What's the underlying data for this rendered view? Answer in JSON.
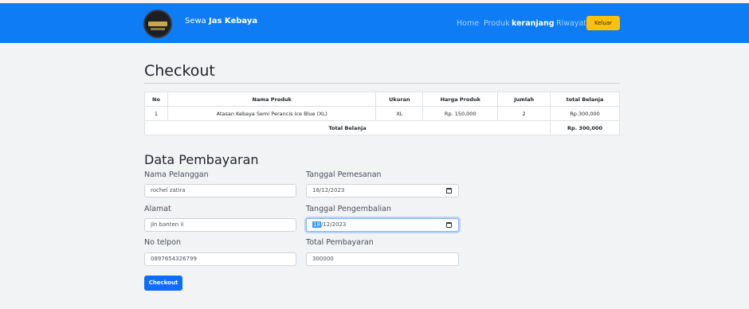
{
  "nav": {
    "brand_prefix": "Sewa",
    "brand_name": "Jas Kebaya",
    "links": [
      "Home",
      "Produk",
      "keranjang",
      "Riwayat"
    ],
    "logout_label": "Keluar",
    "bg_color": "#0d7cf5"
  },
  "page": {
    "title": "Checkout"
  },
  "table": {
    "columns": [
      "No",
      "Nama Produk",
      "Ukuran",
      "Harga Produk",
      "Jumlah",
      "total Belanja"
    ],
    "rows": [
      [
        "1",
        "Atasan Kebaya Semi Perancis Ice Blue (XL)",
        "XL",
        "Rp. 150,000",
        "2",
        "Rp.300,000"
      ]
    ],
    "total_label": "Total Belanja",
    "total_value": "Rp. 300,000"
  },
  "payment": {
    "section_title": "Data Pembayaran",
    "customer_name": {
      "label": "Nama Pelanggan",
      "value": "rochel zatira"
    },
    "order_date": {
      "label": "Tanggal Pemesanan",
      "value": "18/12/2023"
    },
    "address": {
      "label": "Alamat",
      "value": "jln banten ii"
    },
    "return_date": {
      "label": "Tanggal Pengembalian",
      "value_selected": "18",
      "value_rest": "/12/2023"
    },
    "phone": {
      "label": "No telpon",
      "value": "0897654326799"
    },
    "total_payment": {
      "label": "Total Pembayaran",
      "value": "300000"
    }
  },
  "checkout_button": "Checkout"
}
